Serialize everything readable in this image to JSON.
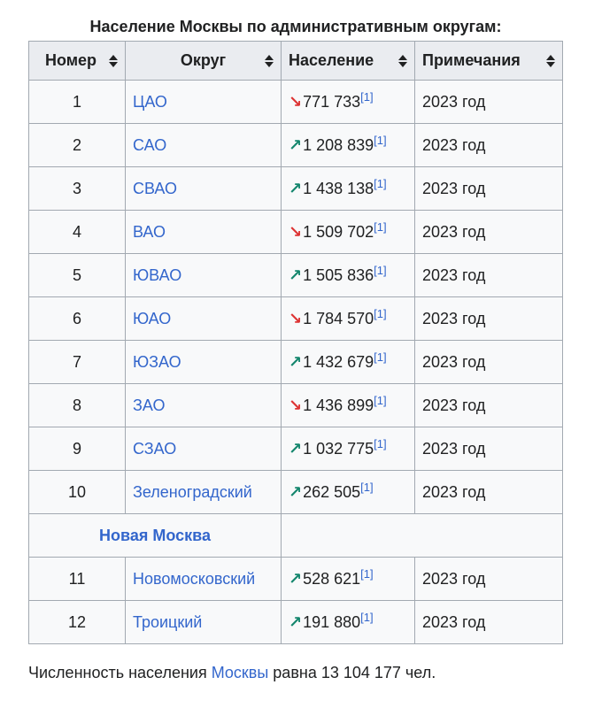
{
  "caption": "Население Москвы по административным округам:",
  "headers": [
    "Номер",
    "Округ",
    "Население",
    "Примечания"
  ],
  "rows": [
    {
      "num": "1",
      "district": "ЦАО",
      "trend": "down",
      "population": "771 733",
      "ref": "[1]",
      "note": "2023 год"
    },
    {
      "num": "2",
      "district": "САО",
      "trend": "up",
      "population": "1 208 839",
      "ref": "[1]",
      "note": "2023 год"
    },
    {
      "num": "3",
      "district": "СВАО",
      "trend": "up",
      "population": "1 438 138",
      "ref": "[1]",
      "note": "2023 год"
    },
    {
      "num": "4",
      "district": "ВАО",
      "trend": "down",
      "population": "1 509 702",
      "ref": "[1]",
      "note": "2023 год"
    },
    {
      "num": "5",
      "district": "ЮВАО",
      "trend": "up",
      "population": "1 505 836",
      "ref": "[1]",
      "note": "2023 год"
    },
    {
      "num": "6",
      "district": "ЮАО",
      "trend": "down",
      "population": "1 784 570",
      "ref": "[1]",
      "note": "2023 год"
    },
    {
      "num": "7",
      "district": "ЮЗАО",
      "trend": "up",
      "population": "1 432 679",
      "ref": "[1]",
      "note": "2023 год"
    },
    {
      "num": "8",
      "district": "ЗАО",
      "trend": "down",
      "population": "1 436 899",
      "ref": "[1]",
      "note": "2023 год"
    },
    {
      "num": "9",
      "district": "СЗАО",
      "trend": "up",
      "population": "1 032 775",
      "ref": "[1]",
      "note": "2023 год"
    },
    {
      "num": "10",
      "district": "Зеленоградский",
      "trend": "up",
      "population": "262 505",
      "ref": "[1]",
      "note": "2023 год"
    }
  ],
  "group_label": "Новая Москва",
  "rows_new": [
    {
      "num": "11",
      "district": "Новомосковский",
      "trend": "up",
      "population": "528 621",
      "ref": "[1]",
      "note": "2023 год"
    },
    {
      "num": "12",
      "district": "Троицкий",
      "trend": "up",
      "population": "191 880",
      "ref": "[1]",
      "note": "2023 год"
    }
  ],
  "arrows": {
    "up": "↗",
    "down": "↘"
  },
  "colors": {
    "link": "#3366cc",
    "up": "#14866d",
    "down": "#dd3333"
  },
  "footer": {
    "before": "Численность населения ",
    "link": "Москвы",
    "after": " равна 13 104 177 чел."
  }
}
